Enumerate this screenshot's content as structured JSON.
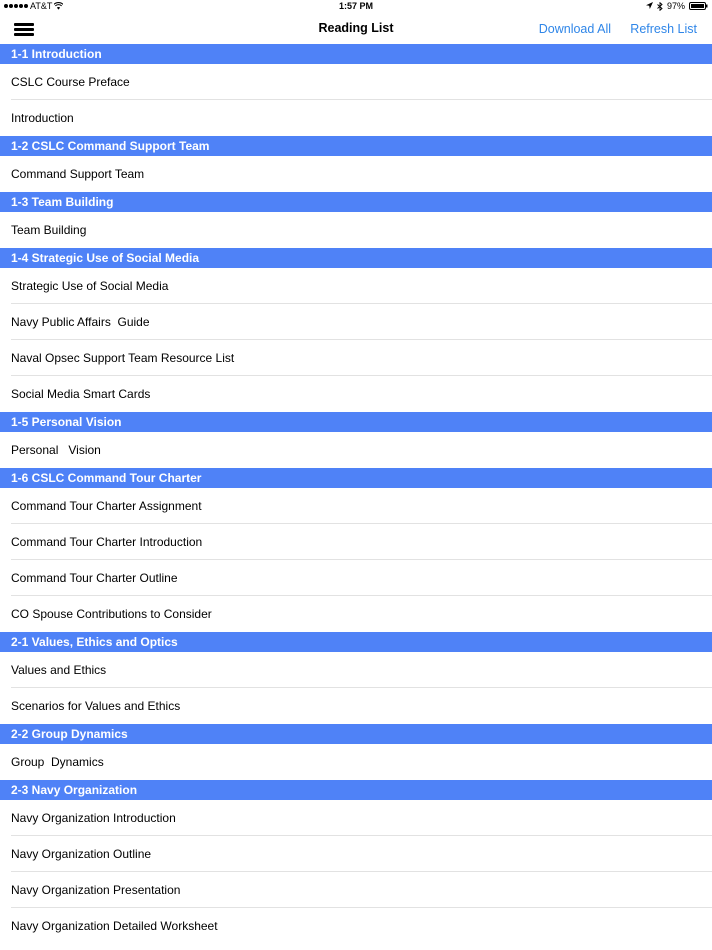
{
  "status_bar": {
    "carrier": "AT&T",
    "time": "1:57 PM",
    "battery": "97%",
    "icons": [
      "signal-dots-icon",
      "wifi-icon",
      "location-arrow-icon",
      "bluetooth-icon",
      "battery-icon"
    ]
  },
  "nav": {
    "title": "Reading List",
    "download_all": "Download All",
    "refresh_list": "Refresh List",
    "menu_icon": "hamburger-menu-icon"
  },
  "colors": {
    "section_header_bg": "#4f82f7",
    "link_blue": "#2f86e8"
  },
  "sections": [
    {
      "title": "1-1 Introduction",
      "items": [
        "CSLC Course Preface",
        "Introduction"
      ]
    },
    {
      "title": "1-2 CSLC Command Support Team",
      "items": [
        "Command Support Team"
      ]
    },
    {
      "title": "1-3 Team Building",
      "items": [
        "Team Building"
      ]
    },
    {
      "title": "1-4 Strategic Use of Social Media",
      "items": [
        "Strategic Use of Social Media",
        "Navy Public Affairs  Guide",
        "Naval Opsec Support Team Resource List",
        "Social Media Smart Cards"
      ]
    },
    {
      "title": "1-5 Personal Vision",
      "items": [
        "Personal   Vision"
      ]
    },
    {
      "title": "1-6 CSLC Command Tour Charter",
      "items": [
        "Command Tour Charter Assignment",
        "Command Tour Charter Introduction",
        "Command Tour Charter Outline",
        "CO Spouse Contributions to Consider"
      ]
    },
    {
      "title": "2-1 Values, Ethics and Optics",
      "items": [
        "Values and Ethics",
        "Scenarios for Values and Ethics"
      ]
    },
    {
      "title": "2-2 Group Dynamics",
      "items": [
        "Group  Dynamics"
      ]
    },
    {
      "title": "2-3 Navy Organization",
      "items": [
        "Navy Organization Introduction",
        "Navy Organization Outline",
        "Navy Organization Presentation",
        "Navy Organization Detailed Worksheet"
      ]
    }
  ]
}
